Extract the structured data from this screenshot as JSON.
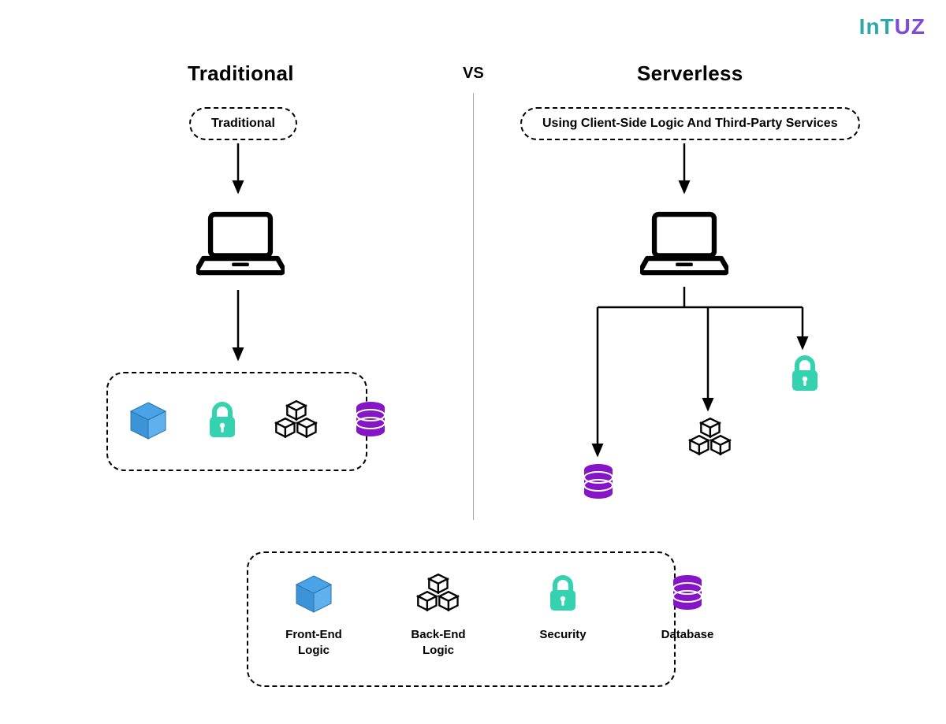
{
  "brand": {
    "part1": "InT",
    "part2": "UZ"
  },
  "headings": {
    "left": "Traditional",
    "vs": "VS",
    "right": "Serverless"
  },
  "pills": {
    "traditional": "Traditional",
    "serverless": "Using Client-Side Logic And Third-Party Services"
  },
  "legend": {
    "items": [
      {
        "icon": "cube",
        "label": "Front-End Logic"
      },
      {
        "icon": "cubes",
        "label": "Back-End Logic"
      },
      {
        "icon": "lock",
        "label": "Security"
      },
      {
        "icon": "database",
        "label": "Database"
      }
    ]
  },
  "traditional_box_icons": [
    "cube",
    "lock",
    "cubes",
    "database"
  ],
  "serverless_branches": [
    "database",
    "cubes",
    "lock"
  ],
  "colors": {
    "cube": "#4aa3e6",
    "lock": "#35d2b0",
    "cubes": "#000000",
    "database": "#8515c7"
  }
}
